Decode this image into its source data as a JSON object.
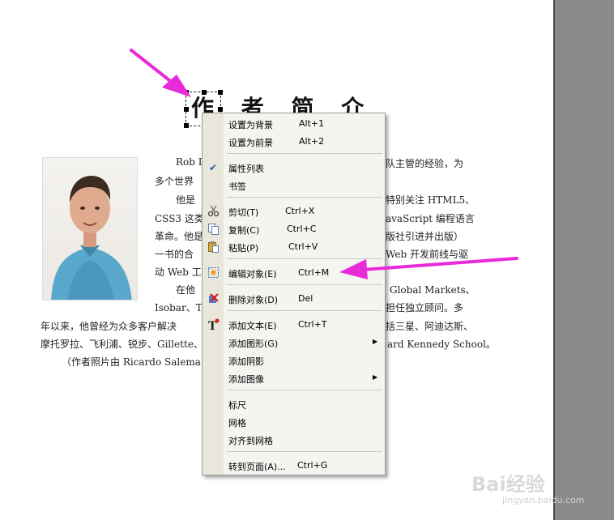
{
  "document": {
    "title": "作 者 简 介",
    "lines": [
      "Rob L",
      "队主管的经验，为",
      "多个世界",
      "他是",
      "特别关注 HTML5、",
      "CSS3 这类",
      "avaScript 编程语言",
      "革命。他是",
      "版社引进并出版）",
      "一书的合",
      "Web 开发前线与驱",
      "动 Web 工",
      "在他",
      "Global Markets、",
      "Isobar、T",
      "担任独立顾问。多",
      "年以来，他曾经为众多客户解决",
      "括三星、阿迪达斯、",
      "摩托罗拉、飞利浦、锐步、Gillette、",
      "ard Kennedy School。",
      "（作者照片由 Ricardo Salema"
    ]
  },
  "context_menu": {
    "items": [
      {
        "label": "设置为背景",
        "shortcut": "Alt+1"
      },
      {
        "label": "设置为前景",
        "shortcut": "Alt+2"
      },
      {
        "label": "属性列表",
        "shortcut": "",
        "checked": true
      },
      {
        "label": "书签",
        "shortcut": ""
      },
      {
        "label": "剪切(T)",
        "shortcut": "Ctrl+X",
        "icon": "scissors-icon"
      },
      {
        "label": "复制(C)",
        "shortcut": "Ctrl+C",
        "icon": "copy-icon"
      },
      {
        "label": "粘贴(P)",
        "shortcut": "Ctrl+V",
        "icon": "paste-icon"
      },
      {
        "label": "编辑对象(E)",
        "shortcut": "Ctrl+M",
        "icon": "edit-object-icon"
      },
      {
        "label": "删除对象(D)",
        "shortcut": "Del",
        "icon": "delete-object-icon"
      },
      {
        "label": "添加文本(E)",
        "shortcut": "Ctrl+T",
        "icon": "add-text-icon"
      },
      {
        "label": "添加图形(G)",
        "shortcut": "",
        "submenu": true
      },
      {
        "label": "添加阴影",
        "shortcut": ""
      },
      {
        "label": "添加图像",
        "shortcut": "",
        "submenu": true
      },
      {
        "label": "标尺",
        "shortcut": ""
      },
      {
        "label": "网格",
        "shortcut": ""
      },
      {
        "label": "对齐到网格",
        "shortcut": ""
      },
      {
        "label": "转到页面(A)...",
        "shortcut": "Ctrl+G"
      }
    ]
  },
  "watermark": {
    "brand": "Bai经验",
    "url": "jingyan.baidu.com"
  },
  "colors": {
    "annotation_arrow": "#e82ad9",
    "menu_bg": "#f4f4f1",
    "menu_gutter": "#e9e6db",
    "check_blue": "#1f5ca8"
  },
  "icons": {
    "submenu_arrow": "▶",
    "checkmark": "✔"
  }
}
